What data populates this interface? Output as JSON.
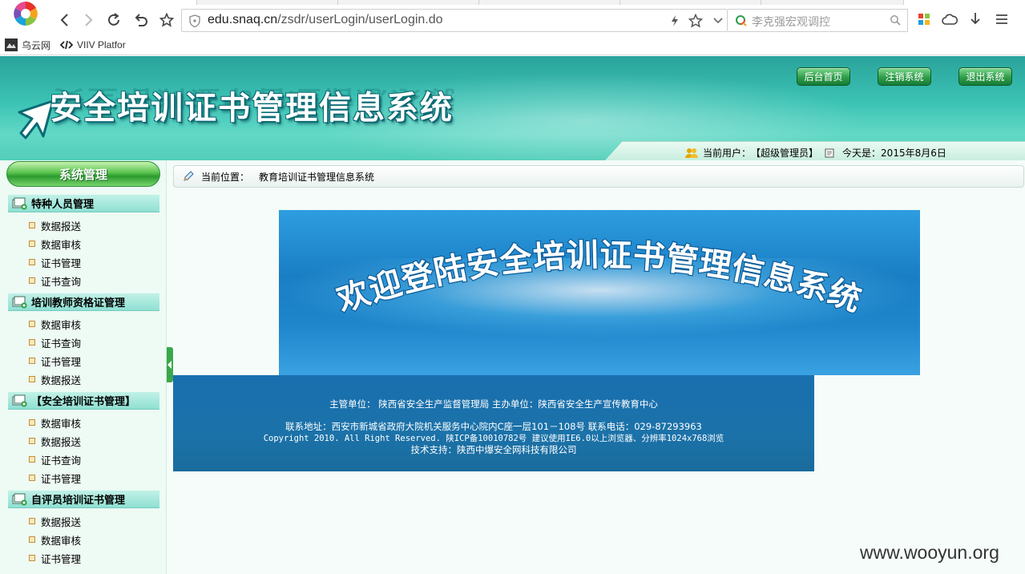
{
  "browser": {
    "url_host": "edu.snaq.cn",
    "url_path": "/zsdr/userLogin/userLogin.do",
    "search_placeholder": "李克强宏观调控",
    "bookmarks": [
      {
        "label": "乌云网"
      },
      {
        "label": "VIIV Platfor"
      }
    ]
  },
  "header": {
    "title": "安全培训证书管理信息系统",
    "buttons": {
      "home": "后台首页",
      "logout_account": "注销系统",
      "exit": "退出系统"
    },
    "user_label": "当前用户：",
    "user_value": "【超级管理员】",
    "date_label": "今天是：",
    "date_value": "2015年8月6日"
  },
  "sidebar": {
    "title": "系统管理",
    "groups": [
      {
        "label": "特种人员管理",
        "items": [
          "数据报送",
          "数据审核",
          "证书管理",
          "证书查询"
        ]
      },
      {
        "label": "培训教师资格证管理",
        "items": [
          "数据审核",
          "证书查询",
          "证书管理",
          "数据报送"
        ]
      },
      {
        "label": "【安全培训证书管理】",
        "items": [
          "数据审核",
          "数据报送",
          "证书查询",
          "证书管理"
        ]
      },
      {
        "label": "自评员培训证书管理",
        "items": [
          "数据报送",
          "数据审核",
          "证书管理"
        ]
      }
    ]
  },
  "main": {
    "location_label": "当前位置：",
    "location_value": "教育培训证书管理信息系统",
    "welcome_text": "欢迎登陆安全培训证书管理信息系统",
    "footer": {
      "line1": "主管单位： 陕西省安全生产监督管理局 主办单位：陕西省安全生产宣传教育中心",
      "line2": "联系地址：西安市新城省政府大院机关服务中心院内C座一层101－108号 联系电话：029-87293963",
      "line3": "Copyright 2010. All Right Reserved. 陕ICP备10010782号 建议使用IE6.0以上浏览器、分辨率1024x768浏览",
      "line4": "技术支持：陕西中爆安全网科技有限公司"
    }
  },
  "watermark": "www.wooyun.org",
  "colors": {
    "banner": "#3cc3b4",
    "button_green": "#2f9d4a",
    "sidebar_group": "#8fe0d3",
    "footer_blue": "#1a6fae"
  }
}
